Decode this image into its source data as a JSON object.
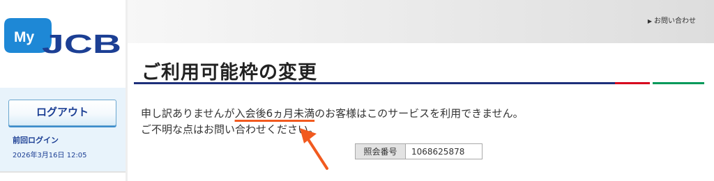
{
  "sidebar": {
    "logo": {
      "text_my": "My",
      "text_jcb": "JCB"
    },
    "logout_label": "ログアウト",
    "last_login_label": "前回ログイン",
    "last_login_time": "2026年3月16日 12:05"
  },
  "header": {
    "contact_label": "お問い合わせ",
    "contact_icon": "triangle-right-icon"
  },
  "main": {
    "title": "ご利用可能枠の変更",
    "message": {
      "line1_before": "申し訳ありませんが",
      "line1_highlight": "入会後6ヵ月未満",
      "line1_after": "のお客様はこのサービスを利用できません。",
      "line2": "ご不明な点はお問い合わせください。"
    },
    "reference": {
      "label": "照会番号",
      "value": "1068625878"
    }
  },
  "colors": {
    "brand_blue": "#1c3f94",
    "logo_light_blue": "#1e88d6",
    "title_line_blue": "#1d2f7a",
    "title_line_red": "#d6001c",
    "title_line_green": "#00995a",
    "annotation_orange": "#f15a1f"
  }
}
